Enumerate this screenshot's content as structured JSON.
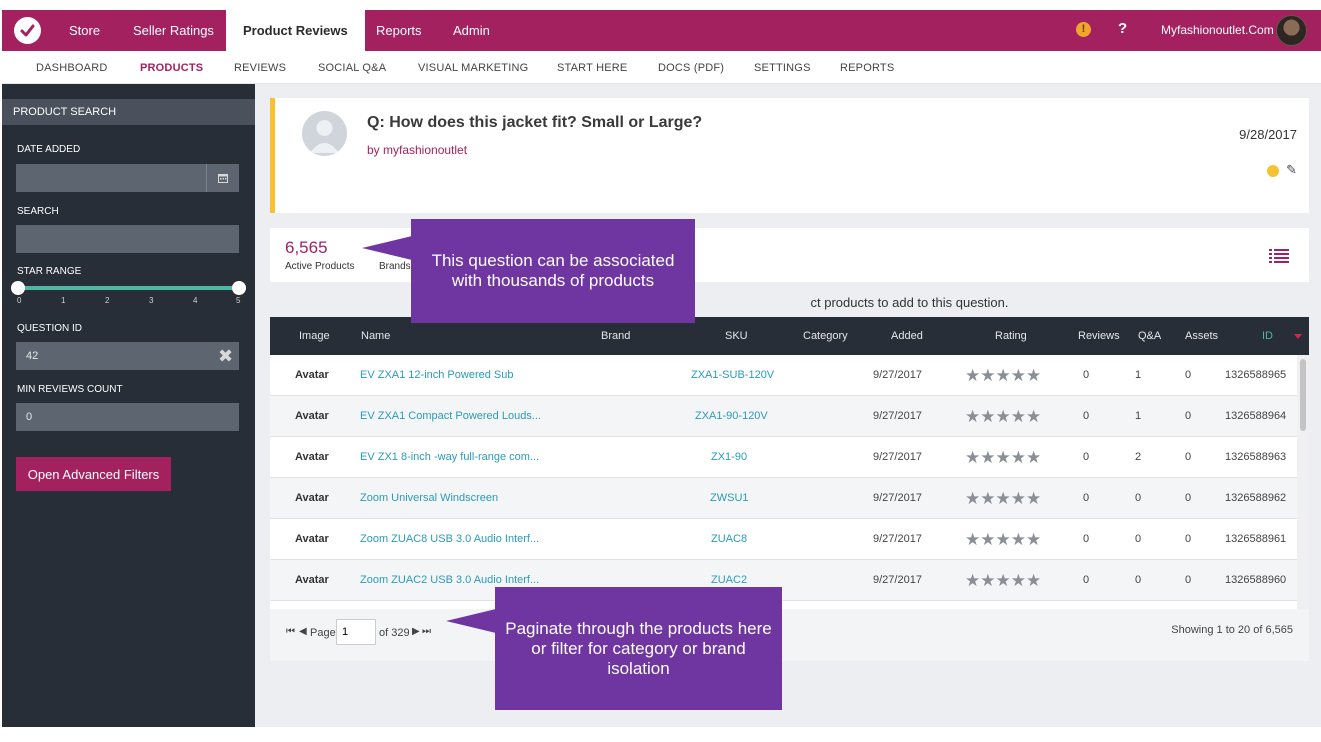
{
  "topnav": {
    "items": [
      {
        "label": "Store"
      },
      {
        "label": "Seller Ratings"
      },
      {
        "label": "Product Reviews"
      },
      {
        "label": "Reports"
      },
      {
        "label": "Admin"
      }
    ],
    "warning_glyph": "!",
    "help_glyph": "?",
    "account": "Myfashionoutlet.Com"
  },
  "subnav": {
    "items": [
      {
        "label": "DASHBOARD"
      },
      {
        "label": "PRODUCTS"
      },
      {
        "label": "REVIEWS"
      },
      {
        "label": "SOCIAL Q&A"
      },
      {
        "label": "VISUAL MARKETING"
      },
      {
        "label": "START HERE"
      },
      {
        "label": "DOCS (PDF)"
      },
      {
        "label": "SETTINGS"
      },
      {
        "label": "REPORTS"
      }
    ]
  },
  "sidebar": {
    "header": "PRODUCT SEARCH",
    "date_added_label": "DATE ADDED",
    "search_label": "SEARCH",
    "star_range_label": "STAR RANGE",
    "star_ticks": [
      "0",
      "1",
      "2",
      "3",
      "4",
      "5"
    ],
    "star_range": [
      0,
      5
    ],
    "question_id_label": "QUESTION ID",
    "question_id_value": "42",
    "min_reviews_label": "MIN REVIEWS COUNT",
    "min_reviews_value": "0",
    "advanced_button": "Open Advanced Filters"
  },
  "question": {
    "title": "Q: How does this jacket fit? Small or Large?",
    "author": "by myfashionoutlet",
    "date": "9/28/2017",
    "edit_glyph": "✎"
  },
  "stats": {
    "active_count": "6,565",
    "active_label": "Active Products",
    "brands_label": "Brands"
  },
  "hint": "ct products to add to this question.",
  "table": {
    "columns": [
      "Image",
      "Name",
      "Brand",
      "SKU",
      "Category",
      "Added",
      "Rating",
      "Reviews",
      "Q&A",
      "Assets",
      "ID"
    ],
    "rows": [
      {
        "image": "Avatar",
        "name": "EV ZXA1 12-inch Powered Sub",
        "brand": "",
        "sku": "ZXA1-SUB-120V",
        "category": "",
        "added": "9/27/2017",
        "rating": "★★★★★",
        "reviews": "0",
        "qa": "1",
        "assets": "0",
        "id": "1326588965"
      },
      {
        "image": "Avatar",
        "name": "EV ZXA1 Compact Powered Louds...",
        "brand": "",
        "sku": "ZXA1-90-120V",
        "category": "",
        "added": "9/27/2017",
        "rating": "★★★★★",
        "reviews": "0",
        "qa": "1",
        "assets": "0",
        "id": "1326588964"
      },
      {
        "image": "Avatar",
        "name": "EV ZX1 8-inch -way full-range com...",
        "brand": "",
        "sku": "ZX1-90",
        "category": "",
        "added": "9/27/2017",
        "rating": "★★★★★",
        "reviews": "0",
        "qa": "2",
        "assets": "0",
        "id": "1326588963"
      },
      {
        "image": "Avatar",
        "name": "Zoom Universal Windscreen",
        "brand": "",
        "sku": "ZWSU1",
        "category": "",
        "added": "9/27/2017",
        "rating": "★★★★★",
        "reviews": "0",
        "qa": "0",
        "assets": "0",
        "id": "1326588962"
      },
      {
        "image": "Avatar",
        "name": "Zoom ZUAC8 USB 3.0 Audio Interf...",
        "brand": "",
        "sku": "ZUAC8",
        "category": "",
        "added": "9/27/2017",
        "rating": "★★★★★",
        "reviews": "0",
        "qa": "0",
        "assets": "0",
        "id": "1326588961"
      },
      {
        "image": "Avatar",
        "name": "Zoom ZUAC2 USB 3.0 Audio Interf...",
        "brand": "",
        "sku": "ZUAC2",
        "category": "",
        "added": "9/27/2017",
        "rating": "★★★★★",
        "reviews": "0",
        "qa": "0",
        "assets": "0",
        "id": "1326588960"
      }
    ]
  },
  "pager": {
    "page_label": "Page",
    "page_value": "1",
    "of_label": "of 329",
    "showing": "Showing 1 to 20 of 6,565"
  },
  "callouts": {
    "first": "This question can be associated with thousands of products",
    "second": "Paginate through the products here or filter for category or brand isolation"
  },
  "colors": {
    "brand": "#a3215f",
    "sidebar": "#272e38",
    "accent": "#4fb6a3",
    "callout": "#6f35a1",
    "link": "#2a9bb8"
  }
}
